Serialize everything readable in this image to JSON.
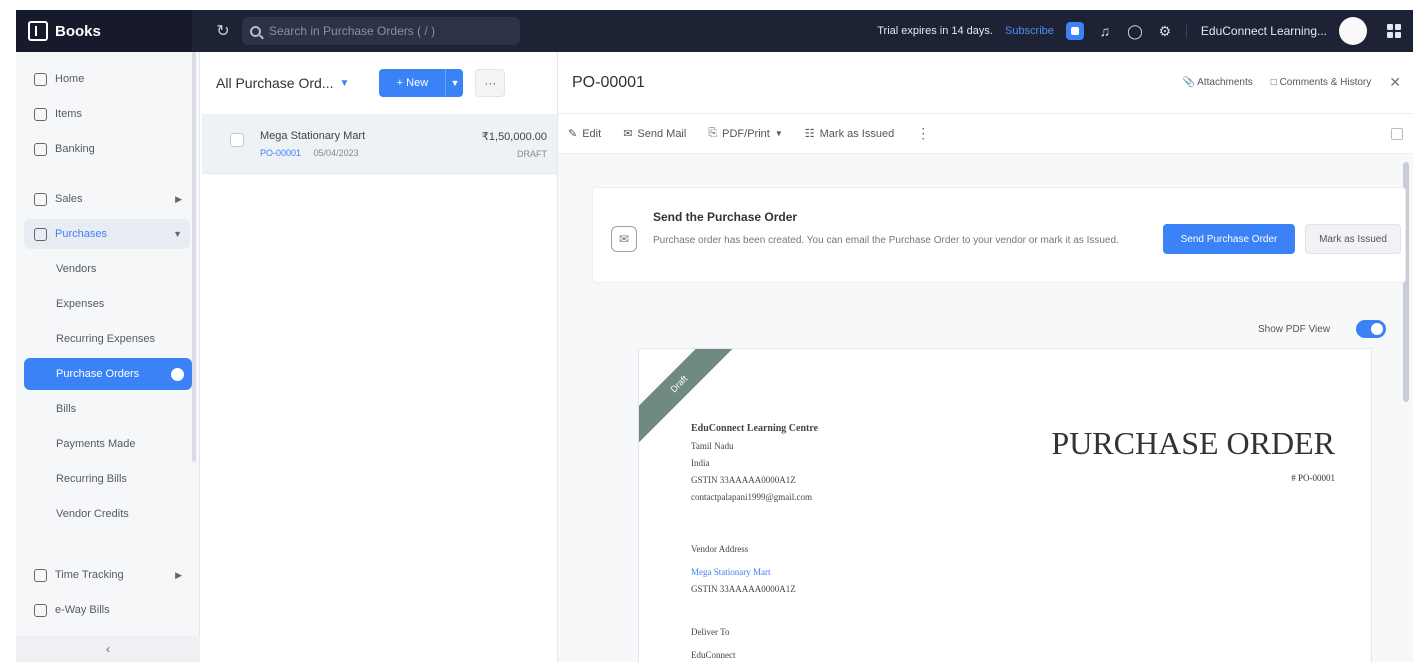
{
  "topbar": {
    "brand": "Books",
    "search_placeholder": "Search in Purchase Orders ( / )",
    "trial": "Trial expires in 14 days.",
    "subscribe": "Subscribe",
    "org_name": "EduConnect Learning..."
  },
  "sidebar": {
    "items": [
      {
        "label": "Home"
      },
      {
        "label": "Items"
      },
      {
        "label": "Banking"
      },
      {
        "label": "Sales"
      },
      {
        "label": "Purchases"
      },
      {
        "label": "Vendors"
      },
      {
        "label": "Expenses"
      },
      {
        "label": "Recurring Expenses"
      },
      {
        "label": "Purchase Orders"
      },
      {
        "label": "Bills"
      },
      {
        "label": "Payments Made"
      },
      {
        "label": "Recurring Bills"
      },
      {
        "label": "Vendor Credits"
      },
      {
        "label": "Time Tracking"
      },
      {
        "label": "e-Way Bills"
      }
    ],
    "collapse_glyph": "‹"
  },
  "list": {
    "title": "All Purchase Ord...",
    "new_label": "+ New",
    "more_label": "···",
    "rows": [
      {
        "vendor": "Mega Stationary Mart",
        "po": "PO-00001",
        "date": "05/04/2023",
        "amount": "₹1,50,000.00",
        "status": "DRAFT"
      }
    ]
  },
  "detail": {
    "po_title": "PO-00001",
    "attachments": "Attachments",
    "comments": "Comments & History",
    "toolbar": {
      "edit": "Edit",
      "send_mail": "Send Mail",
      "pdf_print": "PDF/Print",
      "mark_issued": "Mark as Issued"
    },
    "banner": {
      "title": "Send the Purchase Order",
      "text": "Purchase order has been created. You can email the Purchase Order to your vendor or mark it as Issued.",
      "send_btn": "Send Purchase Order",
      "issued_btn": "Mark as Issued"
    },
    "pdf_view_label": "Show PDF View",
    "document": {
      "ribbon": "Draft",
      "org_name": "EduConnect Learning Centre",
      "org_state": "Tamil Nadu",
      "org_country": "India",
      "org_gstin": "GSTIN 33AAAAA0000A1Z",
      "org_email": "contactpalapani1999@gmail.com",
      "heading": "PURCHASE ORDER",
      "number": "# PO-00001",
      "vendor_label": "Vendor Address",
      "vendor_name": "Mega Stationary Mart",
      "vendor_gstin": "GSTIN 33AAAAA0000A1Z",
      "deliver_label": "Deliver To",
      "deliver_name": "EduConnect"
    }
  }
}
